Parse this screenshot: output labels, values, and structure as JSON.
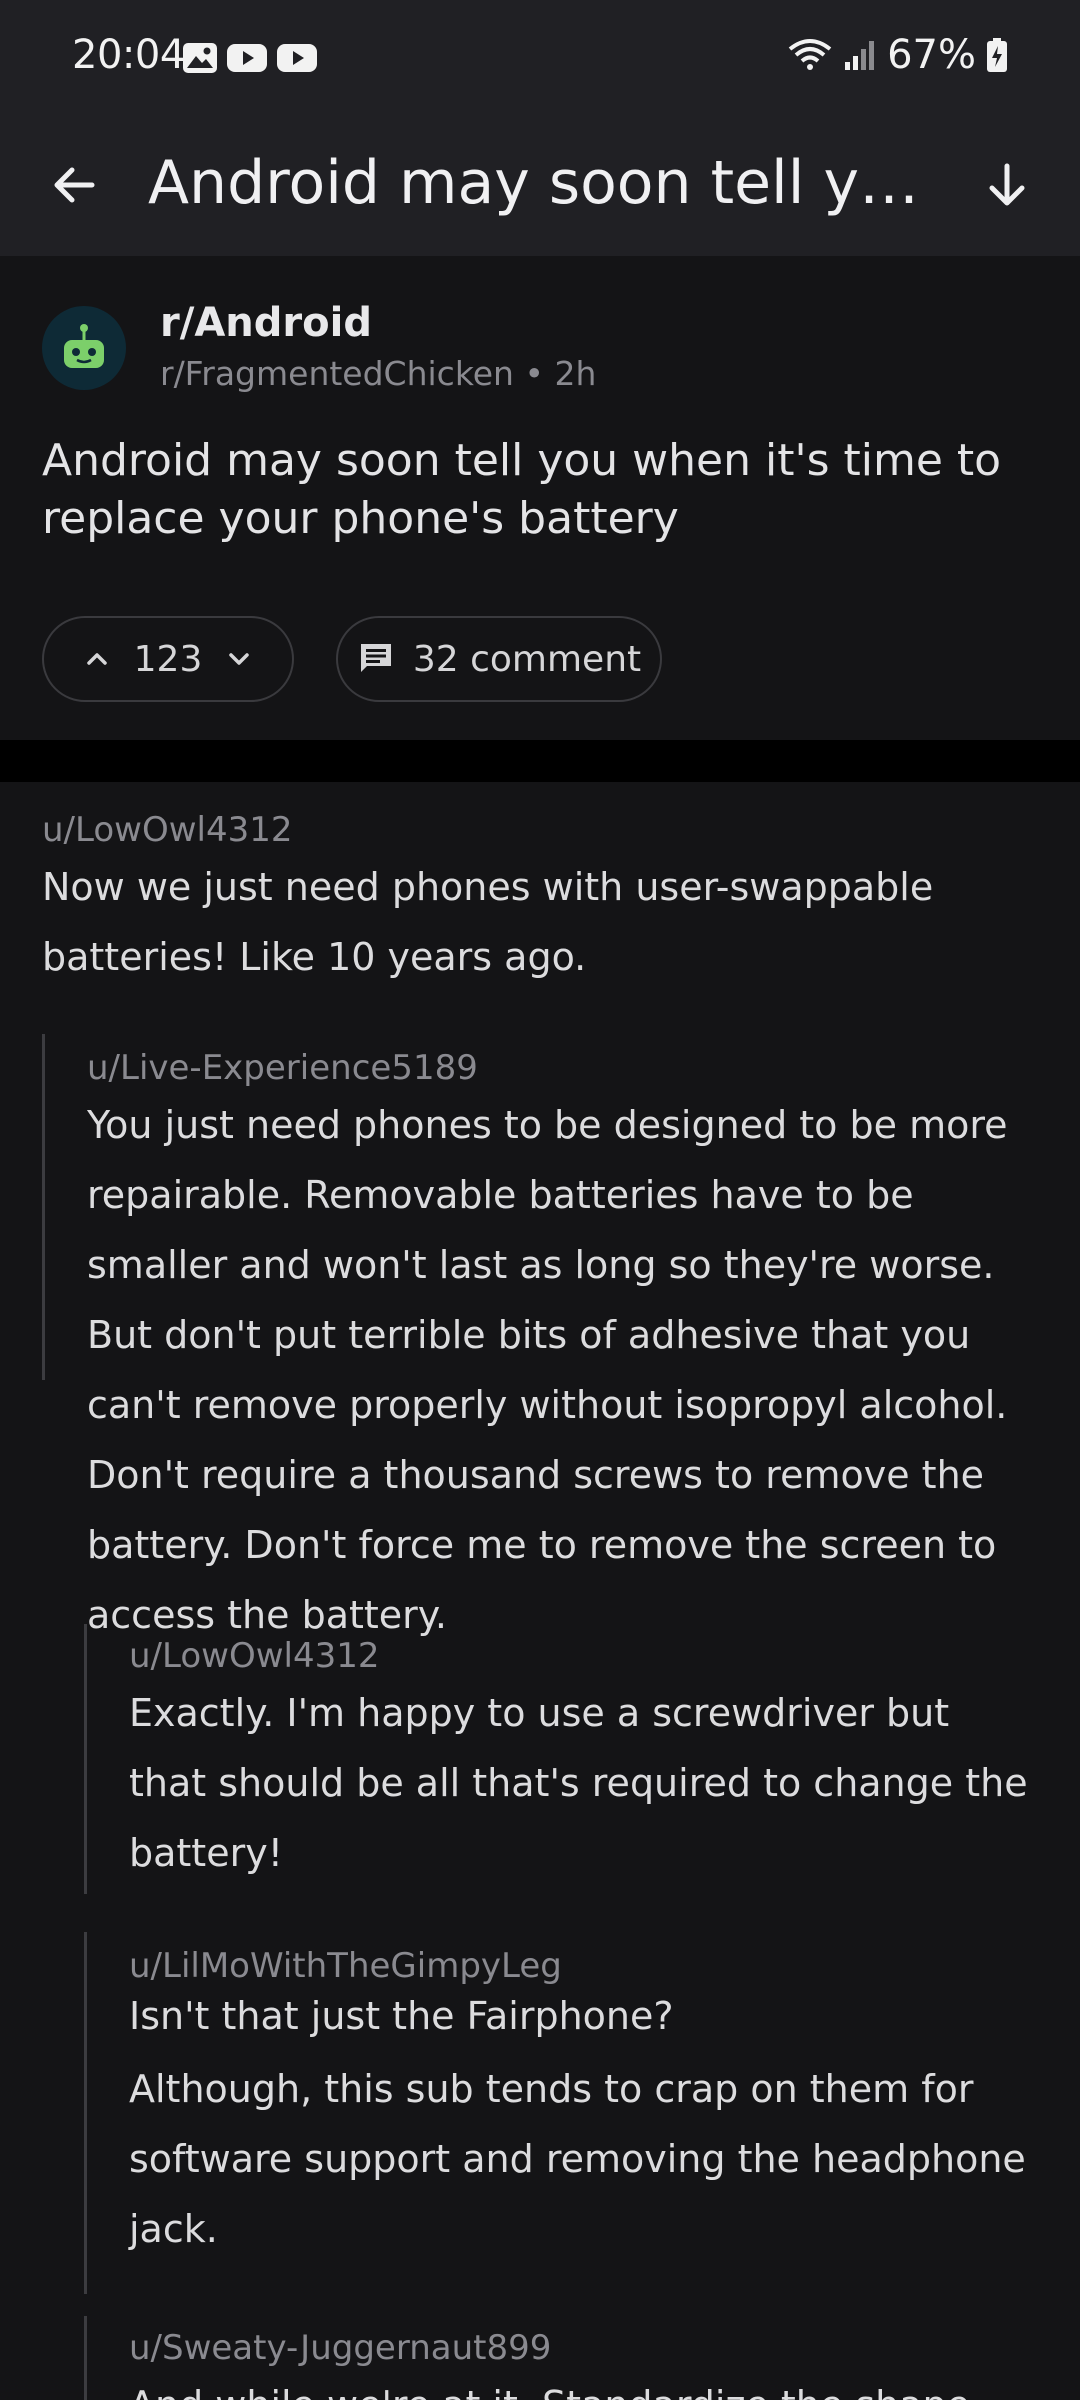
{
  "status_bar": {
    "time": "20:04",
    "battery": "67%",
    "left_icons": [
      "image-icon",
      "youtube-icon",
      "youtube-icon"
    ],
    "right_icons": [
      "wifi-icon",
      "signal-icon",
      "battery-charging-icon"
    ]
  },
  "app_bar": {
    "title": "Android may soon tell you when it's time to replace your phone's battery",
    "back_icon": "arrow-left-icon",
    "next_icon": "arrow-down-icon"
  },
  "post": {
    "subreddit": "r/Android",
    "author": "r/FragmentedChicken",
    "separator": "•",
    "age": "2h",
    "title": "Android may soon tell you when it's time to replace your phone's battery",
    "score": "123",
    "comments_label": "32 comment"
  },
  "comments": [
    {
      "user": "u/LowOwl4312",
      "paragraphs": [
        "Now we just need phones with user-swappable batteries! Like 10 years ago."
      ]
    },
    {
      "user": "u/Live-Experience5189",
      "paragraphs": [
        "You just need phones to be designed to be more repairable. Removable batteries have to be smaller and won't last as long so they're worse. But don't put terrible bits of adhesive that you can't remove properly without isopropyl alcohol. Don't require a thousand screws to remove the battery. Don't force me to remove the screen to access the battery."
      ]
    },
    {
      "user": "u/LowOwl4312",
      "paragraphs": [
        "Exactly. I'm happy to use a screwdriver but that should be all that's required to change the battery!"
      ]
    },
    {
      "user": "u/LilMoWithTheGimpyLeg",
      "paragraphs": [
        "Isn't that just the Fairphone?",
        "Although, this sub tends to crap on them for software support and removing the headphone jack."
      ]
    },
    {
      "user": "u/Sweaty-Juggernaut899",
      "paragraphs": [
        "And while we're at it. Standardize the shape"
      ]
    }
  ],
  "colors": {
    "bar_bg": "#202024",
    "page_bg": "#141416",
    "accent_green": "#7ccf6a",
    "thread_line": "#3c3c40"
  }
}
